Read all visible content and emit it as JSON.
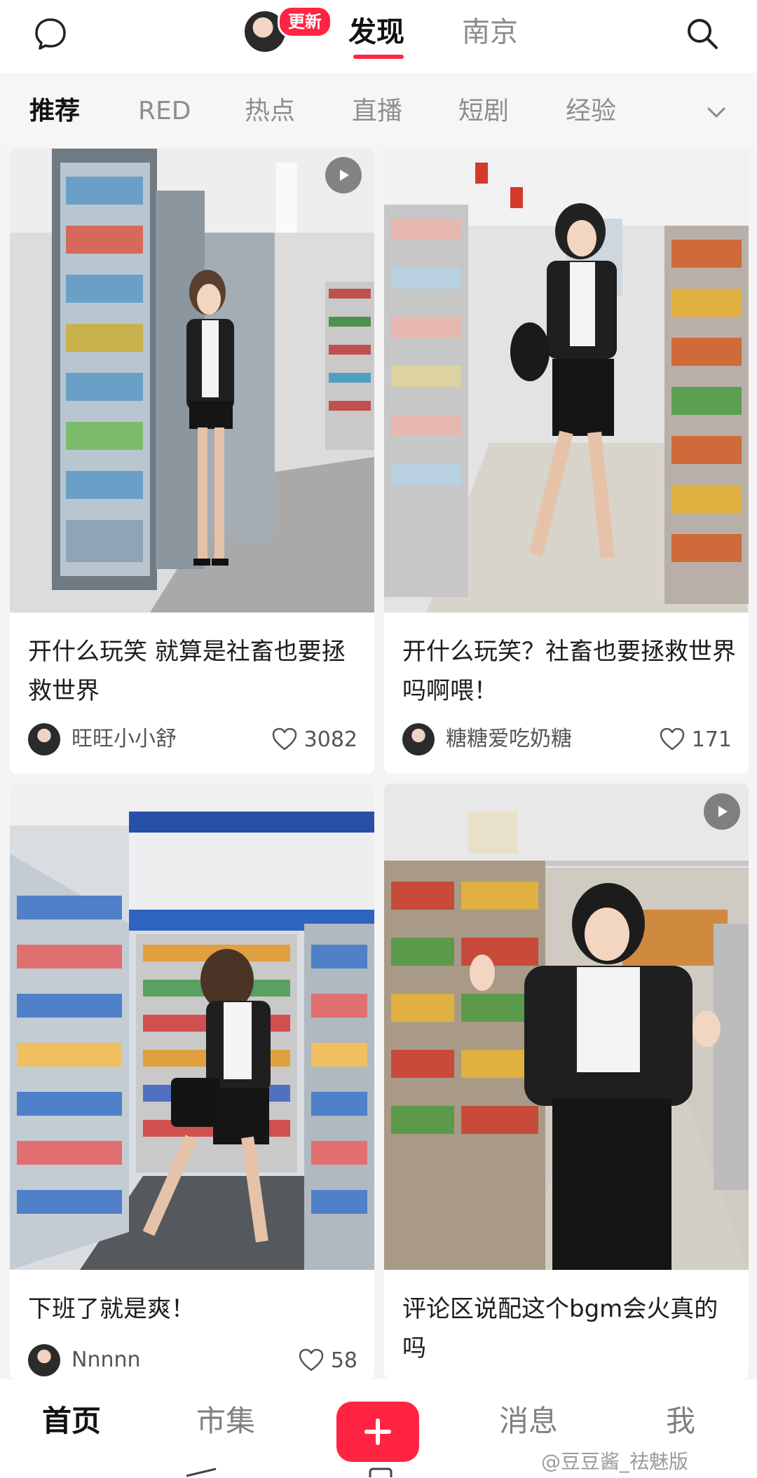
{
  "header": {
    "update_badge": "更新",
    "tabs": [
      {
        "label": "发现",
        "active": true
      },
      {
        "label": "南京",
        "active": false
      }
    ],
    "accent_color": "#ff2442"
  },
  "categories": {
    "items": [
      "推荐",
      "RED",
      "热点",
      "直播",
      "短剧",
      "经验"
    ],
    "active_index": 0
  },
  "feed": [
    {
      "title": "开什么玩笑 就算是社畜也要拯救世界",
      "author": "旺旺小小舒",
      "likes": "3082",
      "is_video": true
    },
    {
      "title": "开什么玩笑？社畜也要拯救世界吗啊喂！",
      "author": "糖糖爱吃奶糖",
      "likes": "171",
      "is_video": false
    },
    {
      "title": "下班了就是爽！",
      "author": "Nnnnn",
      "likes": "58",
      "is_video": false
    },
    {
      "title": "评论区说配这个bgm会火真的吗",
      "author": "",
      "likes": "",
      "is_video": true
    }
  ],
  "bottom_nav": {
    "items": [
      {
        "label": "首页",
        "active": true
      },
      {
        "label": "市集",
        "active": false
      },
      {
        "label": "消息",
        "active": false
      },
      {
        "label": "我",
        "active": false
      }
    ],
    "add_icon": "plus-icon"
  },
  "watermark": "@豆豆酱_祛魅版"
}
